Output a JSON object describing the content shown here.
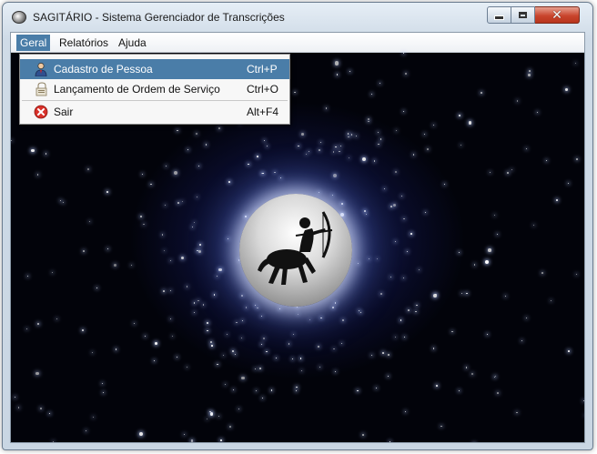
{
  "window": {
    "title": "SAGITÁRIO - Sistema Gerenciador de Transcrições",
    "controls": {
      "minimize_icon": "minimize-icon",
      "maximize_icon": "maximize-icon",
      "close_icon": "close-icon",
      "close_glyph": "✕"
    }
  },
  "menubar": {
    "items": [
      {
        "label": "Geral",
        "active": true
      },
      {
        "label": "Relatórios",
        "active": false
      },
      {
        "label": "Ajuda",
        "active": false
      }
    ]
  },
  "geral_menu": {
    "items": [
      {
        "label": "Cadastro de Pessoa",
        "accelerator": "Ctrl+P",
        "icon": "person-icon",
        "selected": true
      },
      {
        "label": "Lançamento de Ordem de Serviço",
        "accelerator": "Ctrl+O",
        "icon": "service-order-icon",
        "selected": false
      },
      {
        "label": "Sair",
        "accelerator": "Alt+F4",
        "icon": "exit-icon",
        "selected": false
      }
    ]
  },
  "background": {
    "image": "starfield",
    "emblem": "sagittarius-emblem"
  },
  "colors": {
    "menu_highlight": "#4a7da8",
    "close_button": "#c9452d",
    "space": "#02030a",
    "nebula": "#465fdc"
  }
}
